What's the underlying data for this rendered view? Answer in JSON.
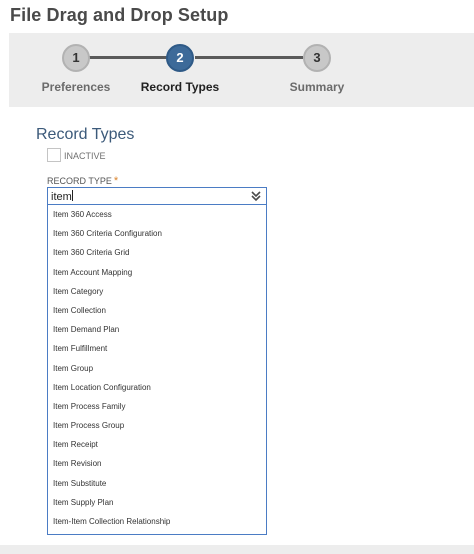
{
  "page": {
    "title": "File Drag and Drop Setup"
  },
  "wizard": {
    "steps": [
      {
        "number": "1",
        "label": "Preferences",
        "state": "complete"
      },
      {
        "number": "2",
        "label": "Record Types",
        "state": "active"
      },
      {
        "number": "3",
        "label": "Summary",
        "state": "pending"
      }
    ]
  },
  "record_types": {
    "section_title": "Record Types",
    "inactive_label": "INACTIVE",
    "inactive_checked": false,
    "record_type_label": "RECORD TYPE",
    "required_marker": "*",
    "record_type_value": "item",
    "options": [
      "Item 360 Access",
      "Item 360 Criteria Configuration",
      "Item 360 Criteria Grid",
      "Item Account Mapping",
      "Item Category",
      "Item Collection",
      "Item Demand Plan",
      "Item Fulfillment",
      "Item Group",
      "Item Location Configuration",
      "Item Process Family",
      "Item Process Group",
      "Item Receipt",
      "Item Revision",
      "Item Substitute",
      "Item Supply Plan",
      "Item-Item Collection Relationship"
    ]
  },
  "colors": {
    "active_step": "#3d6a99",
    "inactive_step": "#c8c8c8",
    "section_title": "#3c5a7a",
    "input_border": "#4b7cc4",
    "required": "#d9822b"
  },
  "icons": {
    "dropdown": "double-chevron-down-icon"
  }
}
